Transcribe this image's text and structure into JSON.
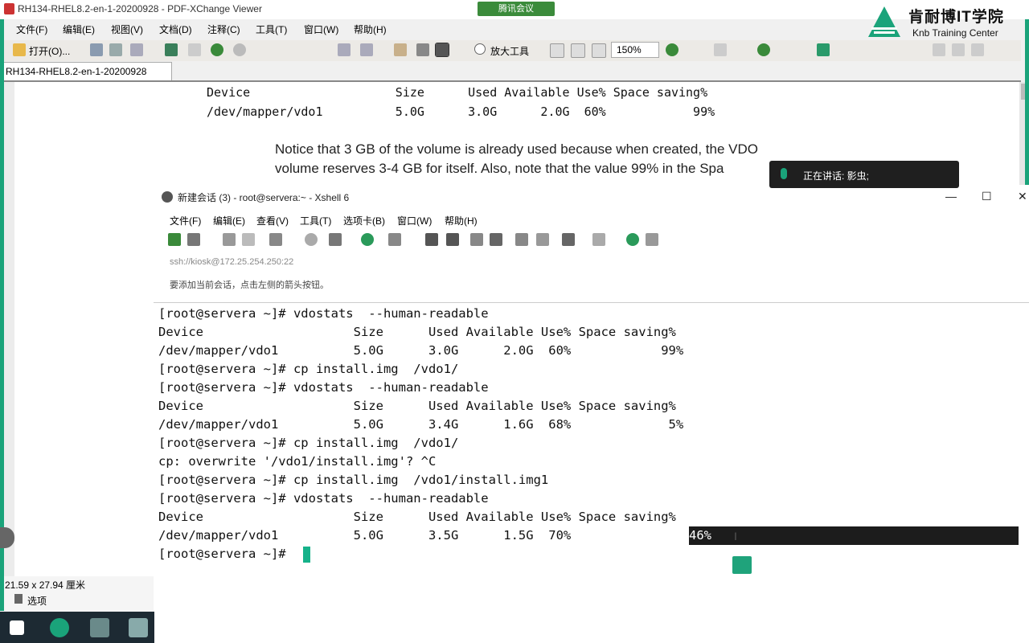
{
  "pdf_viewer": {
    "title": "RH134-RHEL8.2-en-1-20200928 - PDF-XChange Viewer",
    "meeting_badge": "腾讯会议",
    "brand": {
      "name": "肯耐博IT学院",
      "subtitle": "Knb Training Center"
    },
    "menu": [
      "文件(F)",
      "编辑(E)",
      "视图(V)",
      "文档(D)",
      "注释(C)",
      "工具(T)",
      "窗口(W)",
      "帮助(H)"
    ],
    "toolbar": {
      "open_label": "打开(O)...",
      "zoom_tool_label": "放大工具",
      "zoom_value": "150%"
    },
    "tab_label": "RH134-RHEL8.2-en-1-20200928",
    "page": {
      "table_header": "Device                    Size      Used Available Use% Space saving%",
      "table_row": "/dev/mapper/vdo1          5.0G      3.0G      2.0G  60%            99%",
      "prose_line1": "Notice that 3 GB of the volume is already used because when created, the VDO",
      "prose_line2": "volume reserves 3-4 GB for itself. Also, note that the value 99% in the Spa"
    },
    "status": {
      "page_size": "21.59 x 27.94 厘米",
      "options_label": "选项"
    }
  },
  "speaking_overlay": {
    "text": "正在讲话: 影虫;"
  },
  "xshell": {
    "title": "新建会话 (3) - root@servera:~ - Xshell 6",
    "menu": [
      "文件(F)",
      "编辑(E)",
      "查看(V)",
      "工具(T)",
      "选项卡(B)",
      "窗口(W)",
      "帮助(H)"
    ],
    "address": "ssh://kiosk@172.25.254.250:22",
    "hint": "要添加当前会话，点击左侧的箭头按钮。",
    "terminal_lines": [
      "[root@servera ~]# vdostats  --human-readable",
      "Device                    Size      Used Available Use% Space saving%",
      "/dev/mapper/vdo1          5.0G      3.0G      2.0G  60%            99%",
      "[root@servera ~]# cp install.img  /vdo1/",
      "[root@servera ~]# vdostats  --human-readable",
      "Device                    Size      Used Available Use% Space saving%",
      "/dev/mapper/vdo1          5.0G      3.4G      1.6G  68%             5%",
      "[root@servera ~]# cp install.img  /vdo1/",
      "cp: overwrite '/vdo1/install.img'? ^C",
      "[root@servera ~]# cp install.img  /vdo1/install.img1",
      "[root@servera ~]# vdostats  --human-readable",
      "Device                    Size      Used Available Use% Space saving%",
      "/dev/mapper/vdo1          5.0G      3.5G      1.5G  70%",
      "[root@servera ~]# "
    ],
    "selected_text": "46%"
  },
  "colors": {
    "accent_green": "#1aa37a",
    "selection_bg": "#1c1c1c",
    "cursor": "#16b28a"
  }
}
